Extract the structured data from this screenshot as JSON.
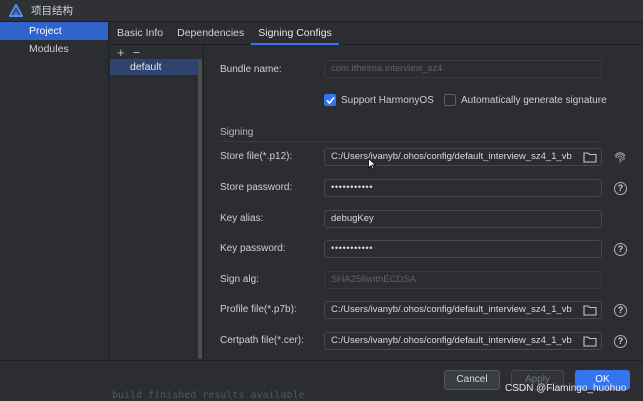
{
  "window": {
    "title": "项目结构"
  },
  "sidebar": {
    "items": [
      {
        "label": "Project",
        "active": true
      },
      {
        "label": "Modules",
        "active": false
      }
    ]
  },
  "tabs": [
    {
      "label": "Basic Info"
    },
    {
      "label": "Dependencies"
    },
    {
      "label": "Signing Configs",
      "active": true
    }
  ],
  "configs": {
    "add_label": "+",
    "remove_label": "−",
    "items": [
      {
        "label": "default"
      }
    ]
  },
  "form": {
    "bundle_name": {
      "label": "Bundle name:",
      "value": "com.itheima.interview_sz4"
    },
    "support_harmonyos": {
      "label": "Support HarmonyOS",
      "checked": true
    },
    "auto_sign": {
      "label": "Automatically generate signature",
      "checked": false
    },
    "section_title": "Signing",
    "store_file": {
      "label": "Store file(*.p12):",
      "value": "C:/Users/ivanyb/.ohos/config/default_interview_sz4_1_vb"
    },
    "store_password": {
      "label": "Store password:",
      "value": "•••••••••••"
    },
    "key_alias": {
      "label": "Key alias:",
      "value": "debugKey"
    },
    "key_password": {
      "label": "Key password:",
      "value": "•••••••••••"
    },
    "sign_alg": {
      "label": "Sign alg:",
      "value": "SHA256withECDSA"
    },
    "profile_file": {
      "label": "Profile file(*.p7b):",
      "value": "C:/Users/ivanyb/.ohos/config/default_interview_sz4_1_vb"
    },
    "certpath_file": {
      "label": "Certpath file(*.cer):",
      "value": "C:/Users/ivanyb/.ohos/config/default_interview_sz4_1_vb"
    },
    "help_glyph": "?"
  },
  "buttons": {
    "cancel": "Cancel",
    "apply": "Apply",
    "ok": "OK"
  },
  "background_text": "build finished  results available",
  "watermark": "CSDN @Flamingo_huohuo",
  "colors": {
    "accent": "#3574f0",
    "selected_nav": "#2f65ca",
    "selected_item": "#2e436e",
    "background": "#2b2d30"
  },
  "icons": [
    "app-logo-icon",
    "folder-icon",
    "fingerprint-icon",
    "help-icon",
    "checkmark-icon",
    "mouse-cursor-icon"
  ]
}
